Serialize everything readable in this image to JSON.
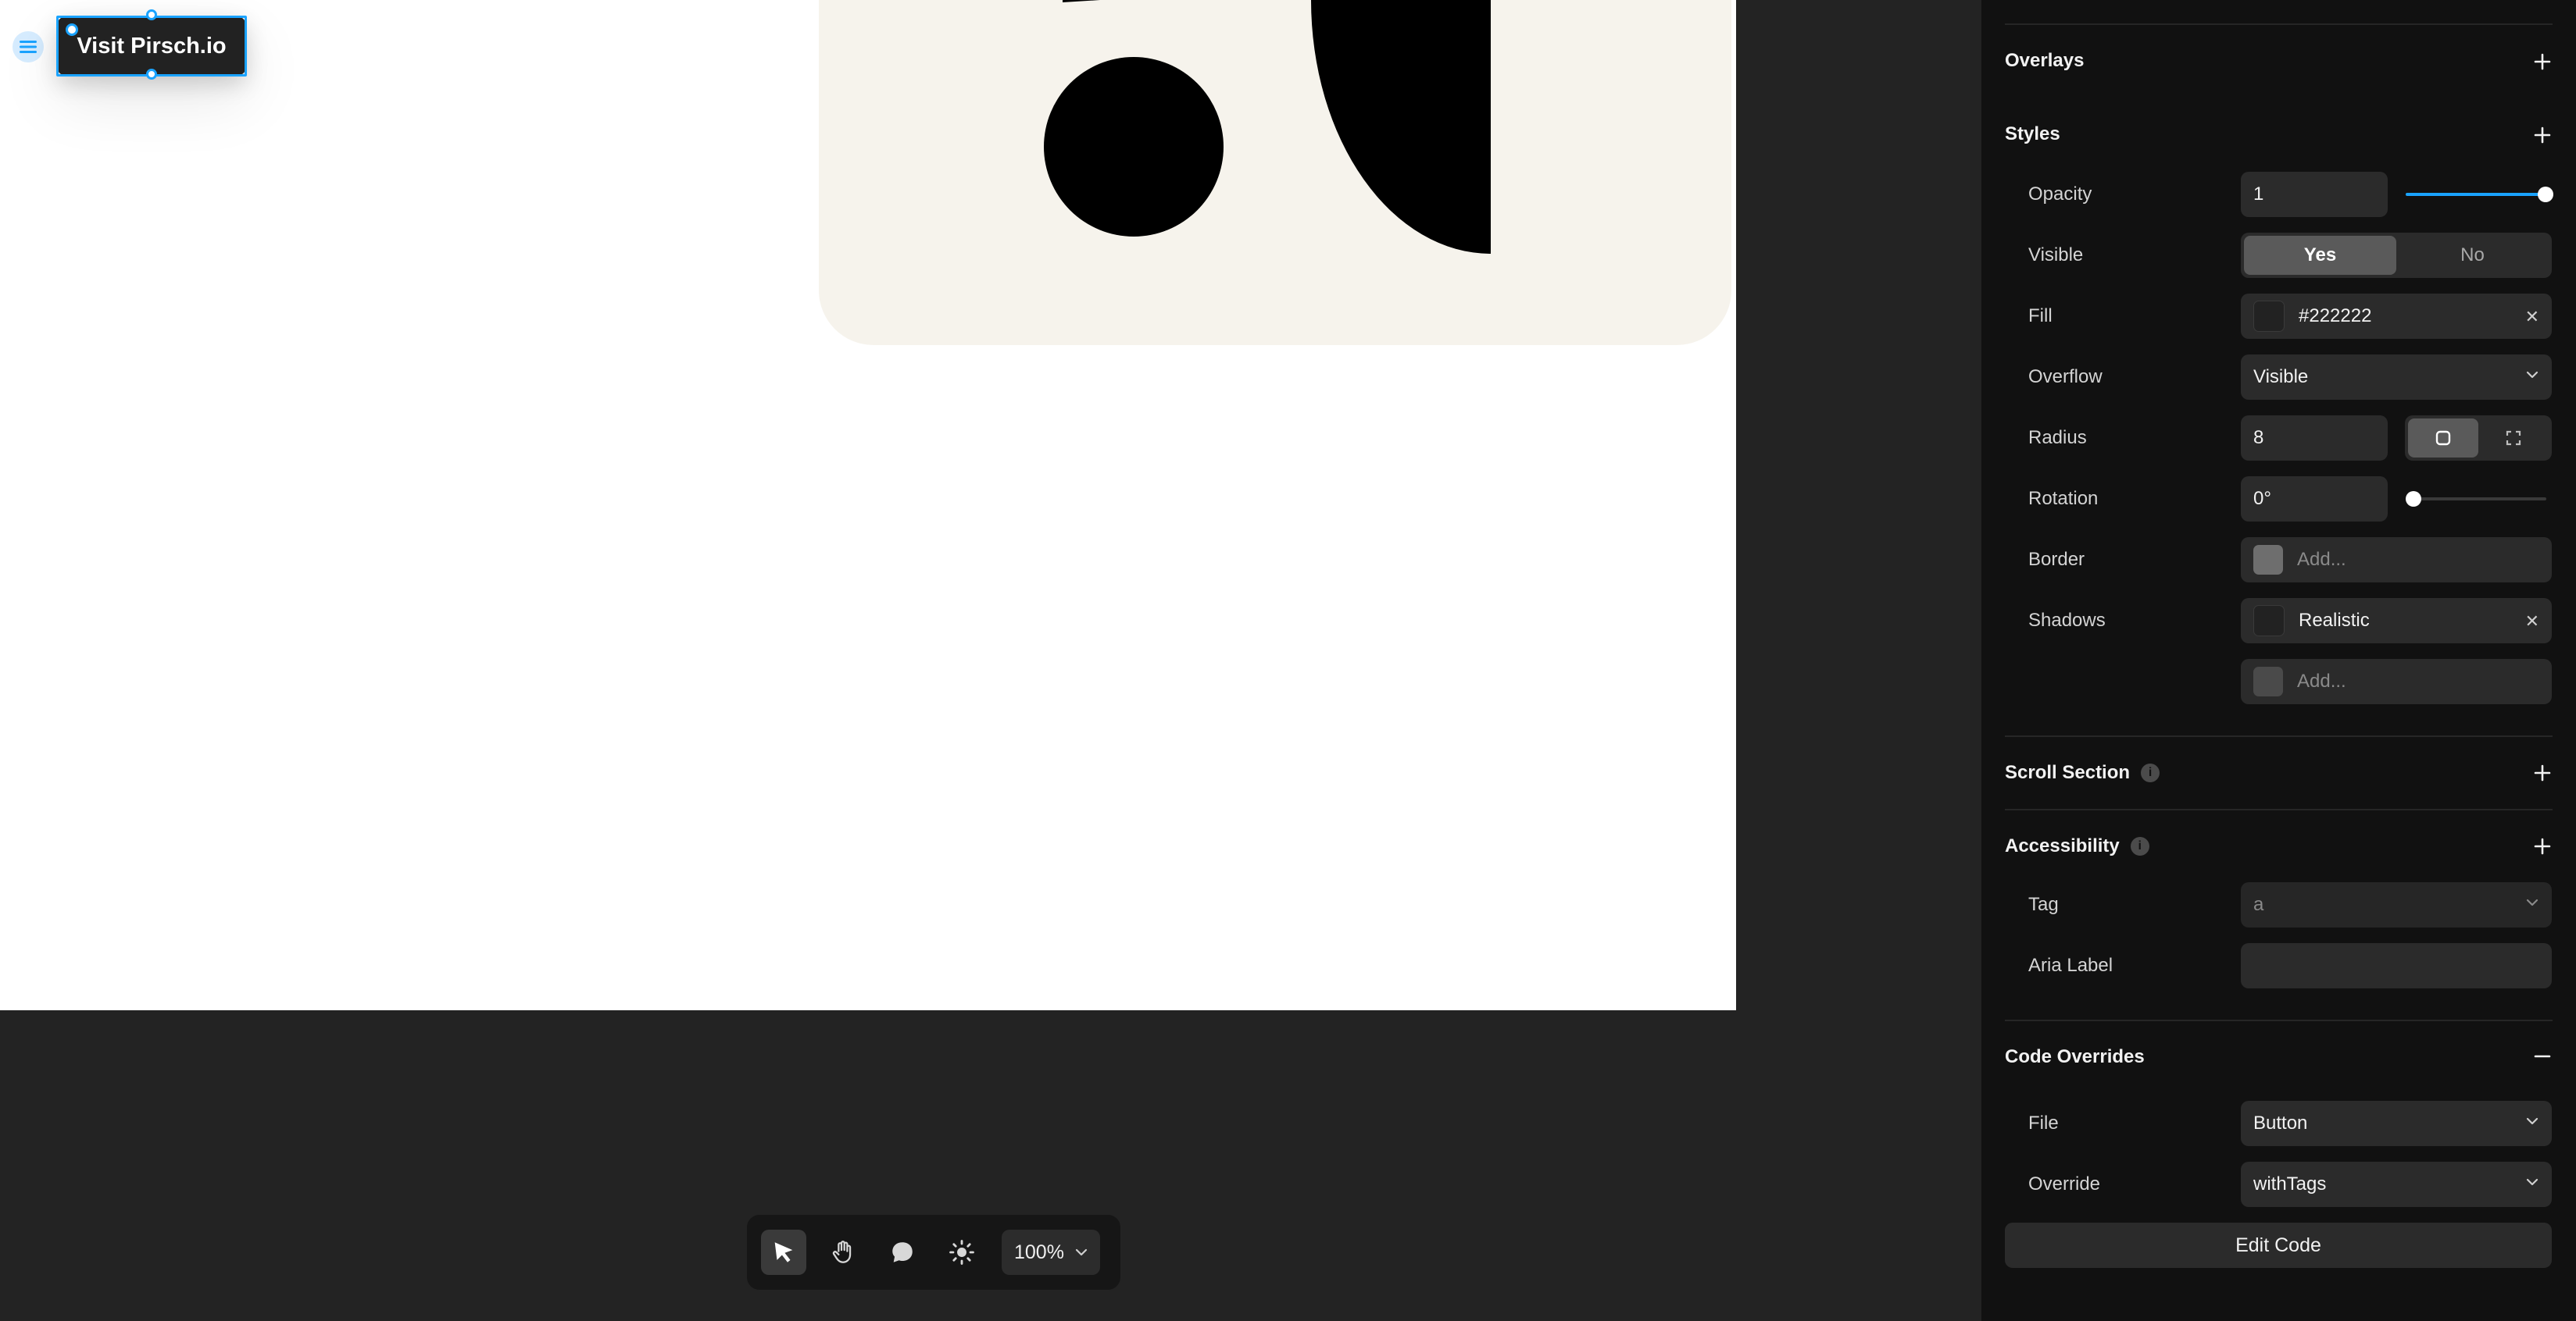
{
  "canvas": {
    "button_label": "Visit Pirsch.io"
  },
  "toolbar": {
    "tools": [
      "select-tool",
      "hand-tool",
      "comment-tool",
      "theme-toggle"
    ],
    "zoom": "100%"
  },
  "panel": {
    "sections": {
      "overlays": "Overlays",
      "styles": "Styles",
      "scroll_section": "Scroll Section",
      "accessibility": "Accessibility",
      "code_overrides": "Code Overrides"
    },
    "styles": {
      "opacity_label": "Opacity",
      "opacity_value": "1",
      "opacity_level": 1.0,
      "visible_label": "Visible",
      "visible_yes": "Yes",
      "visible_no": "No",
      "fill_label": "Fill",
      "fill_value": "#222222",
      "overflow_label": "Overflow",
      "overflow_value": "Visible",
      "radius_label": "Radius",
      "radius_value": "8",
      "rotation_label": "Rotation",
      "rotation_value": "0°",
      "rotation_level": 0,
      "border_label": "Border",
      "border_placeholder": "Add...",
      "shadows_label": "Shadows",
      "shadows_value": "Realistic",
      "shadows_add_placeholder": "Add..."
    },
    "accessibility": {
      "tag_label": "Tag",
      "tag_value": "a",
      "aria_label": "Aria Label",
      "aria_value": ""
    },
    "code_overrides": {
      "file_label": "File",
      "file_value": "Button",
      "override_label": "Override",
      "override_value": "withTags",
      "edit_button": "Edit Code"
    }
  },
  "colors": {
    "accent": "#1aa3ff",
    "panel_bg": "#111111",
    "field_bg": "#2b2b2b",
    "canvas_bg": "#232323",
    "button_fill": "#222222"
  }
}
